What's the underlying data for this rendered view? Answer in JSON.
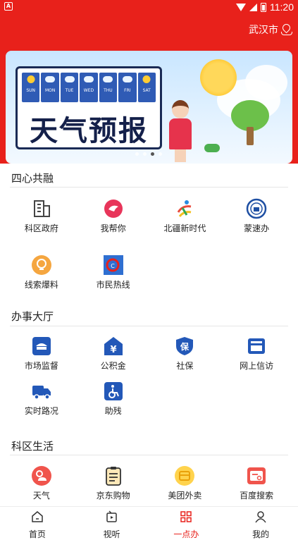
{
  "status_bar": {
    "time": "11:20",
    "left_badge": "A"
  },
  "header": {
    "city": "武汉市"
  },
  "banner": {
    "title": "天气预报",
    "days": [
      "SUN",
      "MON",
      "TUE",
      "WED",
      "THU",
      "FRI",
      "SAT"
    ],
    "dot_count": 4,
    "active_dot": 3
  },
  "sections": [
    {
      "title": "四心共融",
      "items": [
        {
          "label": "科区政府",
          "icon": "building-icon"
        },
        {
          "label": "我帮你",
          "icon": "help-bird-icon"
        },
        {
          "label": "北疆新时代",
          "icon": "runner-logo-icon"
        },
        {
          "label": "蒙速办",
          "icon": "emblem-icon"
        },
        {
          "label": "线索爆料",
          "icon": "lightbulb-icon"
        },
        {
          "label": "市民热线",
          "icon": "hotline-icon"
        }
      ]
    },
    {
      "title": "办事大厅",
      "items": [
        {
          "label": "市场监督",
          "icon": "officer-cap-icon"
        },
        {
          "label": "公积金",
          "icon": "yuan-house-icon"
        },
        {
          "label": "社保",
          "icon": "shield-bao-icon"
        },
        {
          "label": "网上信访",
          "icon": "inbox-icon"
        },
        {
          "label": "实时路况",
          "icon": "truck-icon"
        },
        {
          "label": "助残",
          "icon": "wheelchair-icon"
        }
      ]
    },
    {
      "title": "科区生活",
      "items": [
        {
          "label": "天气",
          "icon": "weather-icon"
        },
        {
          "label": "京东购物",
          "icon": "clipboard-icon"
        },
        {
          "label": "美团外卖",
          "icon": "delivery-box-icon"
        },
        {
          "label": "百度搜索",
          "icon": "search-card-icon"
        }
      ]
    }
  ],
  "tabbar": {
    "active": 2,
    "tabs": [
      {
        "label": "首页",
        "icon": "home-icon"
      },
      {
        "label": "视听",
        "icon": "tv-icon"
      },
      {
        "label": "一点办",
        "icon": "grid-icon"
      },
      {
        "label": "我的",
        "icon": "person-icon"
      }
    ]
  },
  "colors": {
    "brand_red": "#e8211b",
    "service_blue": "#2358b8",
    "orange": "#f5a640"
  }
}
